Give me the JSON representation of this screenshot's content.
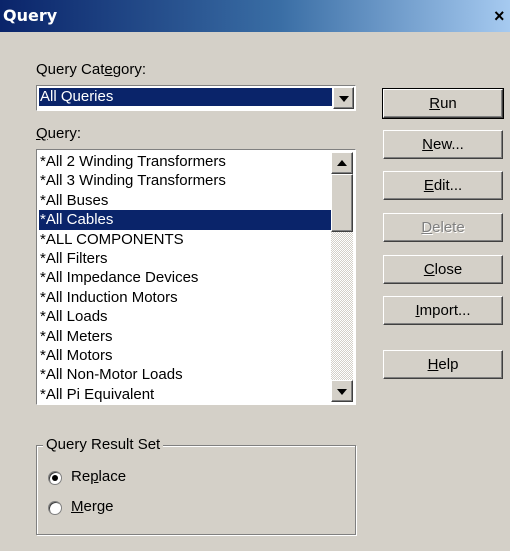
{
  "window": {
    "title": "Query",
    "close_glyph": "×"
  },
  "category": {
    "label": "Query Category:",
    "selected": "All Queries"
  },
  "query": {
    "label": "Query:",
    "items": [
      "*All 2 Winding Transformers",
      "*All 3 Winding Transformers",
      "*All Buses",
      "*All Cables",
      "*ALL COMPONENTS",
      "*All Filters",
      "*All Impedance Devices",
      "*All Induction Motors",
      "*All Loads",
      "*All Meters",
      "*All Motors",
      "*All Non-Motor Loads",
      "*All Pi Equivalent"
    ],
    "selected_index": 3
  },
  "buttons": {
    "run": "Run",
    "new": "New...",
    "edit": "Edit...",
    "delete": "Delete",
    "close": "Close",
    "import": "Import...",
    "help": "Help"
  },
  "result_set": {
    "label": "Query Result Set",
    "replace": "Replace",
    "merge": "Merge",
    "selected": "Replace"
  },
  "colors": {
    "selection": "#0a246a",
    "face": "#d4d0c8"
  }
}
